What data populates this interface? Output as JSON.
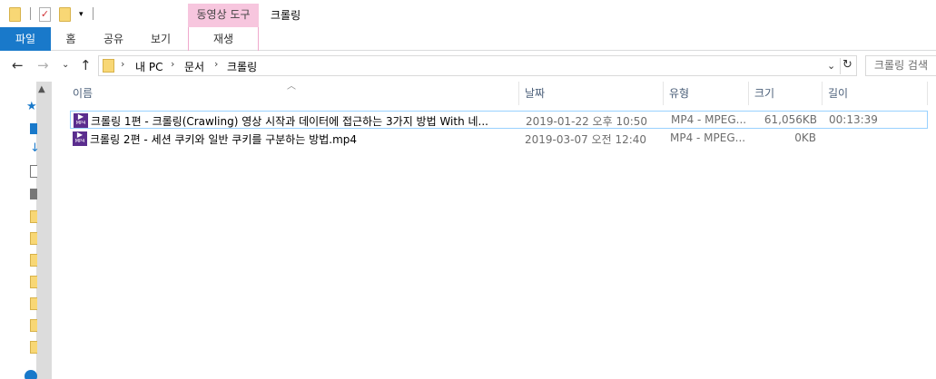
{
  "window": {
    "title": "크롤링",
    "context_tab": "동영상 도구"
  },
  "ribbon": {
    "tabs": [
      {
        "label": "파일",
        "active": true
      },
      {
        "label": "홈"
      },
      {
        "label": "공유"
      },
      {
        "label": "보기"
      },
      {
        "label": "재생"
      }
    ]
  },
  "address": {
    "crumbs": [
      "내 PC",
      "문서",
      "크롤링"
    ],
    "search_placeholder": "크롤링 검색"
  },
  "columns": {
    "name": "이름",
    "date": "날짜",
    "type": "유형",
    "size": "크기",
    "length": "길이"
  },
  "files": [
    {
      "name": "크롤링 1편 - 크롤링(Crawling) 영상 시작과 데이터에 접근하는 3가지 방법 With 네...",
      "date": "2019-01-22 오후 10:50",
      "type": "MP4 - MPEG...",
      "size": "61,056KB",
      "length": "00:13:39",
      "selected": true,
      "icon": "mp4-file-icon"
    },
    {
      "name": "크롤링 2편 - 세션 쿠키와 일반 쿠키를 구분하는 방법.mp4",
      "date": "2019-03-07 오전 12:40",
      "type": "MP4 - MPEG...",
      "size": "0KB",
      "length": "",
      "selected": false,
      "icon": "mp4-file-icon"
    }
  ],
  "colors": {
    "file_tab": "#1979ca",
    "context_tab": "#f7c6de",
    "selection_border": "#99d1ff"
  }
}
